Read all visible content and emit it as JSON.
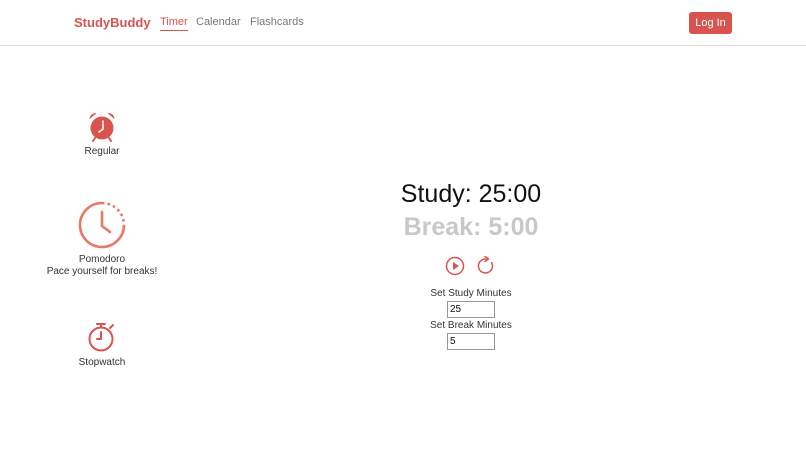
{
  "nav": {
    "brand": "StudyBuddy",
    "links": [
      {
        "label": "Timer",
        "active": true
      },
      {
        "label": "Calendar",
        "active": false
      },
      {
        "label": "Flashcards",
        "active": false
      }
    ],
    "login_label": "Log In"
  },
  "modes": {
    "regular": {
      "label": "Regular",
      "icon": "alarm-clock-icon"
    },
    "pomodoro": {
      "label": "Pomodoro",
      "subtitle": "Pace yourself for breaks!",
      "icon": "dashed-clock-icon"
    },
    "stopwatch": {
      "label": "Stopwatch",
      "icon": "stopwatch-icon"
    }
  },
  "timer": {
    "study": "Study: 25:00",
    "break": "Break: 5:00"
  },
  "settings": {
    "study_label": "Set Study Minutes",
    "study_value": "25",
    "break_label": "Set Break Minutes",
    "break_value": "5"
  },
  "colors": {
    "accent": "#d9534f",
    "clock": "#e87966",
    "muted": "#c8c8c8"
  }
}
